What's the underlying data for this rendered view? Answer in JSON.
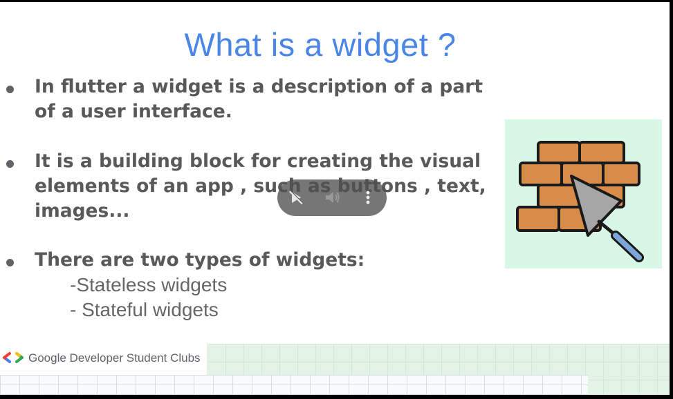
{
  "slide": {
    "title": "What is a widget ?",
    "bullets": [
      {
        "lines": [
          "In flutter a widget is a description of a part",
          "of a user interface."
        ]
      },
      {
        "lines": [
          "It is a building block for creating the visual",
          "elements of an app , such as buttons , text,",
          "images..."
        ]
      },
      {
        "lines": [
          "There are two types of widgets:"
        ]
      }
    ],
    "widget_types": [
      "-Stateless widgets",
      "- Stateful widgets"
    ],
    "illustration": "brick-wall-trowel-icon",
    "footer_brand": "Google Developer Student Clubs"
  },
  "player_controls": {
    "play_button_icon": "pause-play-icon",
    "volume_icon": "volume-icon",
    "more_icon": "more-vertical-icon"
  },
  "colors": {
    "title": "#4a86e8",
    "text": "#595959",
    "illustration_bg": "#d9f7e6",
    "brick": "#d88c4a"
  }
}
